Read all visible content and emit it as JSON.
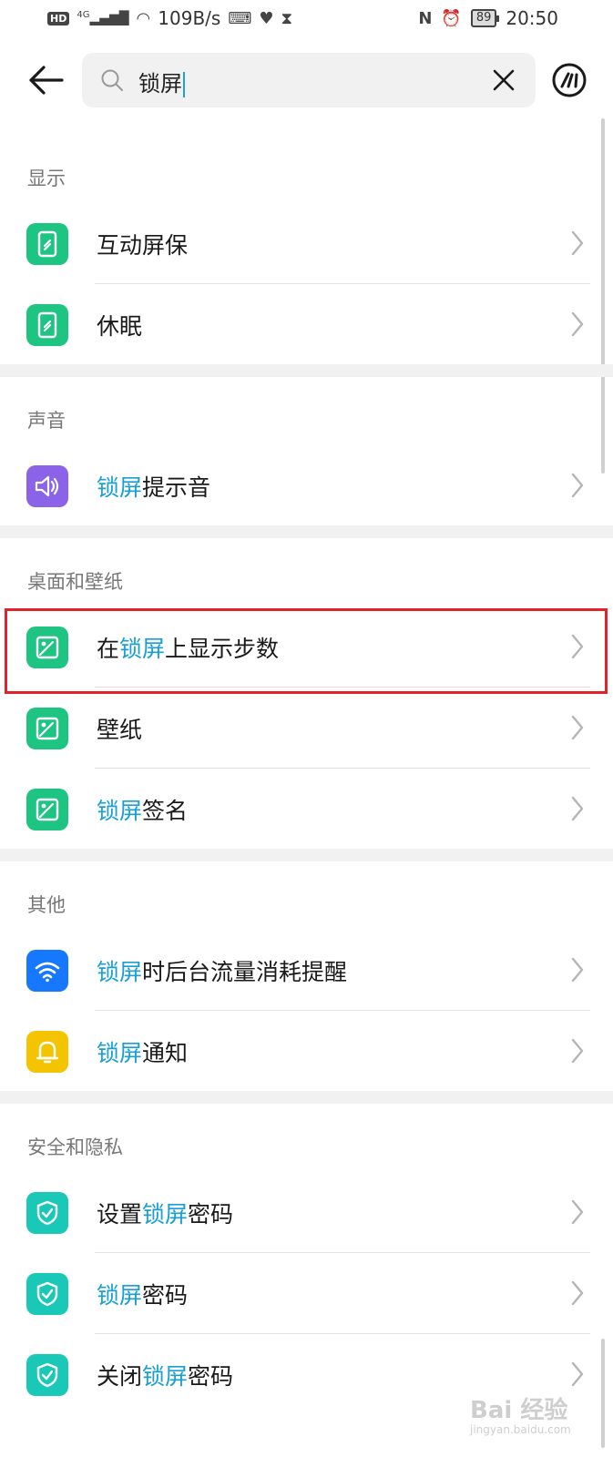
{
  "status_bar": {
    "hd_label": "HD",
    "network_label": "4G",
    "speed": "109B/s",
    "battery": "89",
    "time": "20:50",
    "icons": [
      "signal-icon",
      "wifi-icon",
      "keyboard-icon",
      "health-icon",
      "hourglass-icon",
      "nfc-icon",
      "alarm-icon",
      "battery-icon"
    ]
  },
  "search": {
    "query": "锁屏",
    "icons": [
      "back-arrow-icon",
      "search-icon",
      "clear-icon",
      "assistant-icon"
    ]
  },
  "highlight_color": "#1a9fd2",
  "sections": [
    {
      "title": "显示",
      "items": [
        {
          "pre": "",
          "hl": "",
          "post": "互动屏保",
          "icon": "phone-icon",
          "color": "#1ec482"
        },
        {
          "pre": "",
          "hl": "",
          "post": "休眠",
          "icon": "phone-icon",
          "color": "#1ec482"
        }
      ]
    },
    {
      "title": "声音",
      "items": [
        {
          "pre": "",
          "hl": "锁屏",
          "post": "提示音",
          "icon": "speaker-icon",
          "color": "#8a63e8"
        }
      ]
    },
    {
      "title": "桌面和壁纸",
      "items": [
        {
          "pre": "在",
          "hl": "锁屏",
          "post": "上显示步数",
          "icon": "wallpaper-icon",
          "color": "#1ec482"
        },
        {
          "pre": "",
          "hl": "",
          "post": "壁纸",
          "icon": "wallpaper-icon",
          "color": "#1ec482"
        },
        {
          "pre": "",
          "hl": "锁屏",
          "post": "签名",
          "icon": "wallpaper-icon",
          "color": "#1ec482"
        }
      ]
    },
    {
      "title": "其他",
      "items": [
        {
          "pre": "",
          "hl": "锁屏",
          "post": "时后台流量消耗提醒",
          "icon": "wifi-icon",
          "color": "#1677ff"
        },
        {
          "pre": "",
          "hl": "锁屏",
          "post": "通知",
          "icon": "bell-icon",
          "color": "#f5c400"
        }
      ]
    },
    {
      "title": "安全和隐私",
      "items": [
        {
          "pre": "设置",
          "hl": "锁屏",
          "post": "密码",
          "icon": "shield-icon",
          "color": "#1ac8b8"
        },
        {
          "pre": "",
          "hl": "锁屏",
          "post": "密码",
          "icon": "shield-icon",
          "color": "#1ac8b8"
        },
        {
          "pre": "关闭",
          "hl": "锁屏",
          "post": "密码",
          "icon": "shield-icon",
          "color": "#1ac8b8"
        }
      ]
    }
  ],
  "watermark": {
    "main": "Bai 经验",
    "sub": "jingyan.baidu.com"
  }
}
